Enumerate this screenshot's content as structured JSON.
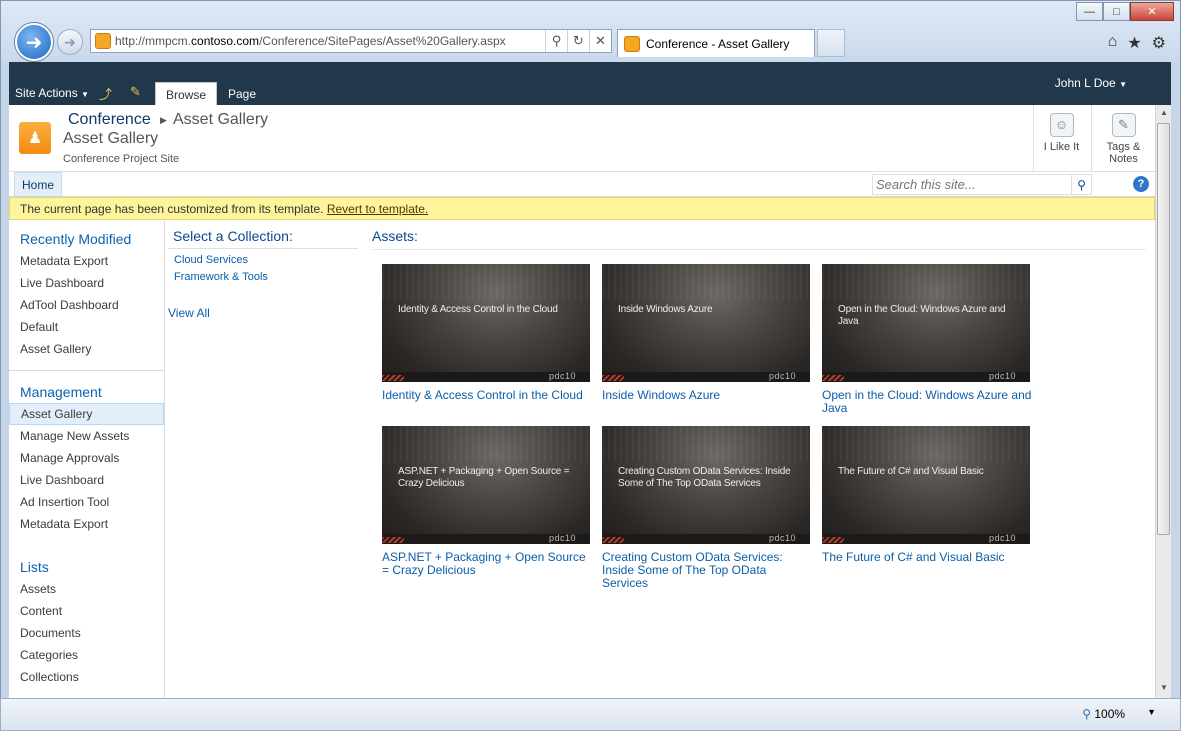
{
  "browser": {
    "url_prefix": "http://mmpcm.",
    "url_domain": "contoso.com",
    "url_path": "/Conference/SitePages/Asset%20Gallery.aspx",
    "tab_title": "Conference - Asset Gallery",
    "zoom": "100%"
  },
  "ribbon": {
    "site_actions": "Site Actions",
    "tab_browse": "Browse",
    "tab_page": "Page",
    "user": "John L Doe"
  },
  "title": {
    "crumb_site": "Conference",
    "crumb_page": "Asset Gallery",
    "page_title": "Asset Gallery",
    "description": "Conference Project Site",
    "like_label": "I Like It",
    "tags_label": "Tags &",
    "notes_label": "Notes"
  },
  "topnav": {
    "home": "Home",
    "search_placeholder": "Search this site..."
  },
  "status": {
    "message": "The current page has been customized from its template.",
    "link": "Revert to template."
  },
  "leftnav": {
    "recent_heading": "Recently Modified",
    "recent_items": [
      "Metadata Export",
      "Live Dashboard",
      "AdTool Dashboard",
      "Default",
      "Asset Gallery"
    ],
    "management_heading": "Management",
    "management_items": [
      "Asset Gallery",
      "Manage New Assets",
      "Manage Approvals",
      "Live Dashboard",
      "Ad Insertion Tool",
      "Metadata Export"
    ],
    "lists_heading": "Lists",
    "lists_items": [
      "Assets",
      "Content",
      "Documents",
      "Categories",
      "Collections"
    ]
  },
  "collections": {
    "title": "Select a Collection:",
    "items": [
      "Cloud Services",
      "Framework & Tools"
    ],
    "view_all": "View All"
  },
  "assets": {
    "title": "Assets:",
    "thumb_logo": "pdc10",
    "items": [
      {
        "thumb_title": "Identity & Access Control in the Cloud",
        "link": "Identity & Access Control in the Cloud"
      },
      {
        "thumb_title": "Inside Windows Azure",
        "link": "Inside Windows Azure"
      },
      {
        "thumb_title": "Open in the Cloud: Windows Azure and Java",
        "link": "Open in the Cloud: Windows Azure and Java"
      },
      {
        "thumb_title": "ASP.NET + Packaging + Open Source = Crazy Delicious",
        "link": "ASP.NET + Packaging + Open Source = Crazy Delicious"
      },
      {
        "thumb_title": "Creating Custom OData Services: Inside Some of The Top OData Services",
        "link": "Creating Custom OData Services: Inside Some of The Top OData Services"
      },
      {
        "thumb_title": "The Future of C# and Visual Basic",
        "link": "The Future of C# and Visual Basic"
      }
    ]
  }
}
